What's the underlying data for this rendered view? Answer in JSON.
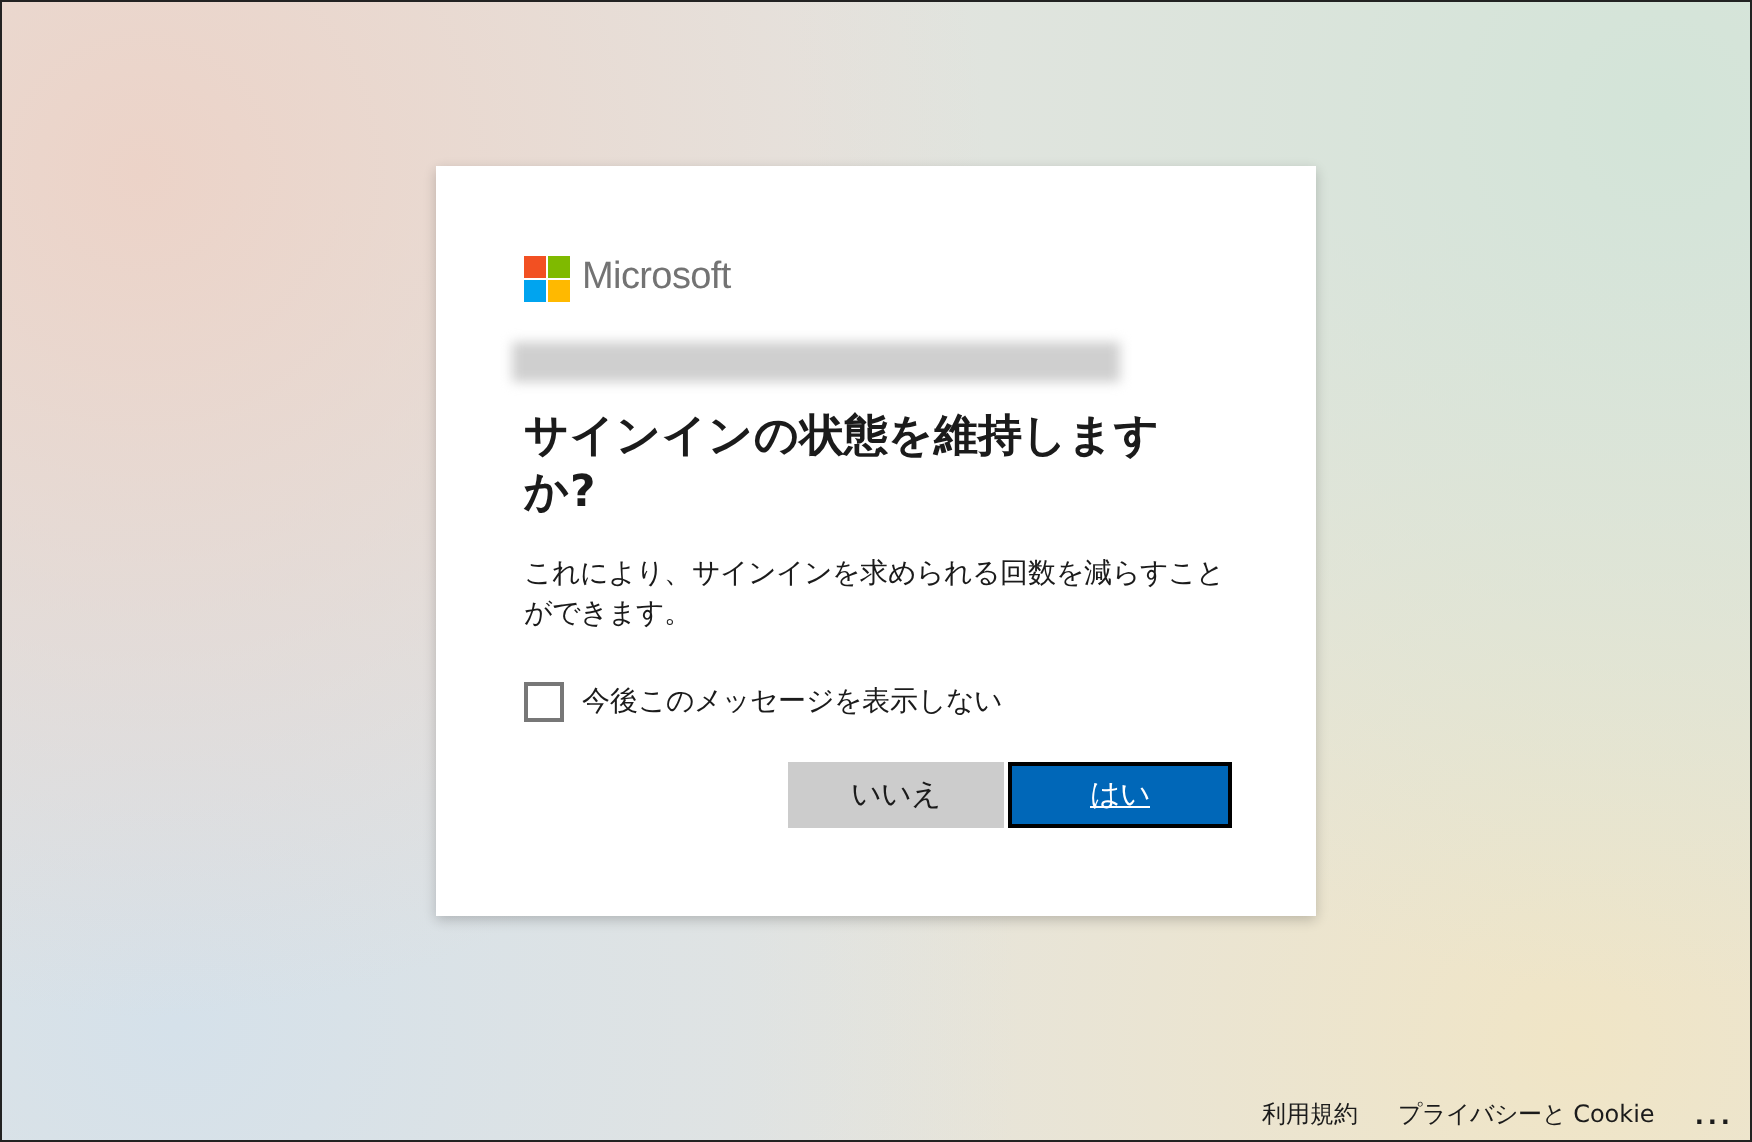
{
  "logo": {
    "name": "Microsoft"
  },
  "title": "サインインの状態を維持しますか?",
  "description": "これにより、サインインを求められる回数を減らすことができます。",
  "checkbox": {
    "label": "今後このメッセージを表示しない",
    "checked": false
  },
  "buttons": [
    {
      "label": "いいえ",
      "kind": "secondary"
    },
    {
      "label": "はい",
      "kind": "primary"
    }
  ],
  "footer": {
    "links": [
      "利用規約",
      "プライバシーと Cookie"
    ],
    "more": "..."
  }
}
